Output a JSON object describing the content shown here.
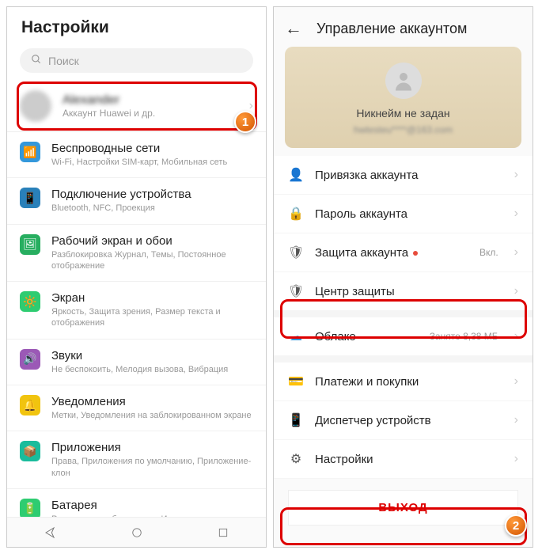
{
  "left": {
    "title": "Настройки",
    "searchPlaceholder": "Поиск",
    "account": {
      "name": "Alexander",
      "sub": "Аккаунт Huawei и др."
    },
    "items": [
      {
        "title": "Беспроводные сети",
        "sub": "Wi-Fi, Настройки SIM-карт, Мобильная сеть",
        "color": "#3498db"
      },
      {
        "title": "Подключение устройства",
        "sub": "Bluetooth, NFC, Проекция",
        "color": "#2980b9"
      },
      {
        "title": "Рабочий экран и обои",
        "sub": "Разблокировка Журнал, Темы, Постоянное отображение",
        "color": "#27ae60"
      },
      {
        "title": "Экран",
        "sub": "Яркость, Защита зрения, Размер текста и отображения",
        "color": "#2ecc71"
      },
      {
        "title": "Звуки",
        "sub": "Не беспокоить, Мелодия вызова, Вибрация",
        "color": "#9b59b6"
      },
      {
        "title": "Уведомления",
        "sub": "Метки, Уведомления на заблокированном экране",
        "color": "#f1c40f"
      },
      {
        "title": "Приложения",
        "sub": "Права, Приложения по умолчанию, Приложение-клон",
        "color": "#1abc9c"
      },
      {
        "title": "Батарея",
        "sub": "Режим энергосбережения, Использование батареи",
        "color": "#2ecc71"
      }
    ]
  },
  "right": {
    "title": "Управление аккаунтом",
    "card": {
      "nickname": "Никнейм не задан",
      "email": "hwtesteu****@163.com"
    },
    "items": [
      {
        "label": "Привязка аккаунта"
      },
      {
        "label": "Пароль аккаунта"
      },
      {
        "label": "Защита аккаунта",
        "value": "Вкл.",
        "alert": true
      },
      {
        "label": "Центр защиты"
      },
      {
        "label": "Облако",
        "value": "Занято 8,38 МБ",
        "cloud": true
      },
      {
        "label": "Платежи и покупки"
      },
      {
        "label": "Диспетчер устройств"
      },
      {
        "label": "Настройки"
      }
    ],
    "logout": "ВЫХОД"
  },
  "badges": {
    "one": "1",
    "two": "2"
  }
}
